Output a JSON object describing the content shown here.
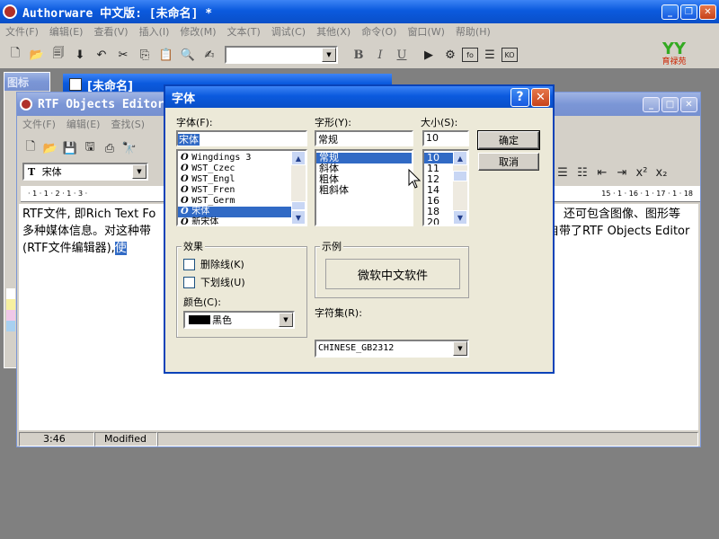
{
  "main_window": {
    "title": "Authorware 中文版: [未命名] *",
    "menu": [
      "文件(F)",
      "编辑(E)",
      "查看(V)",
      "插入(I)",
      "修改(M)",
      "文本(T)",
      "调试(C)",
      "其他(X)",
      "命令(O)",
      "窗口(W)",
      "帮助(H)"
    ],
    "toolbar": {
      "font_combo_value": "",
      "bold": "B",
      "italic": "I",
      "underline": "U"
    },
    "logo_text": "育禄苑"
  },
  "icon_palette": {
    "title": "图标"
  },
  "flow_window": {
    "title": "[未命名]"
  },
  "rtf_window": {
    "title": "RTF Objects Editor",
    "menu": [
      "文件(F)",
      "编辑(E)",
      "查找(S)"
    ],
    "font_value": "宋体",
    "ruler_left": "· 1 · 1 · 2 · 1 · 3 ·",
    "ruler_right": "15 · 1 · 16 · 1 · 17 · 1 · 18",
    "text_left": [
      "RTF文件, 即Rich Text Fo",
      "多种媒体信息。对这种带",
      "(RTF文件编辑器),"
    ],
    "text_sel": "使",
    "text_right": [
      "还可包含图像、图形等",
      "自带了RTF Objects Editor"
    ],
    "status": {
      "position": "3:46",
      "state": "Modified"
    },
    "toolbar_right": {
      "superscript": "x²",
      "subscript": "x₂"
    }
  },
  "font_dialog": {
    "title": "字体",
    "font_label": "字体(F):",
    "font_value": "宋体",
    "font_list": [
      "Wingdings 3",
      "WST_Czec",
      "WST_Engl",
      "WST_Fren",
      "WST_Germ",
      "宋体",
      "新宋体"
    ],
    "font_selected_index": 5,
    "style_label": "字形(Y):",
    "style_value": "常规",
    "style_list": [
      "常规",
      "斜体",
      "粗体",
      "粗斜体"
    ],
    "style_selected_index": 0,
    "size_label": "大小(S):",
    "size_value": "10",
    "size_list": [
      "10",
      "11",
      "12",
      "14",
      "16",
      "18",
      "20"
    ],
    "size_selected_index": 0,
    "ok": "确定",
    "cancel": "取消",
    "effects_label": "效果",
    "strikeout": "删除线(K)",
    "underline": "下划线(U)",
    "color_label": "颜色(C):",
    "color_value": "黑色",
    "sample_label": "示例",
    "sample_text": "微软中文软件",
    "charset_label": "字符集(R):",
    "charset_value": "CHINESE_GB2312",
    "help": "?",
    "close": "✕"
  }
}
